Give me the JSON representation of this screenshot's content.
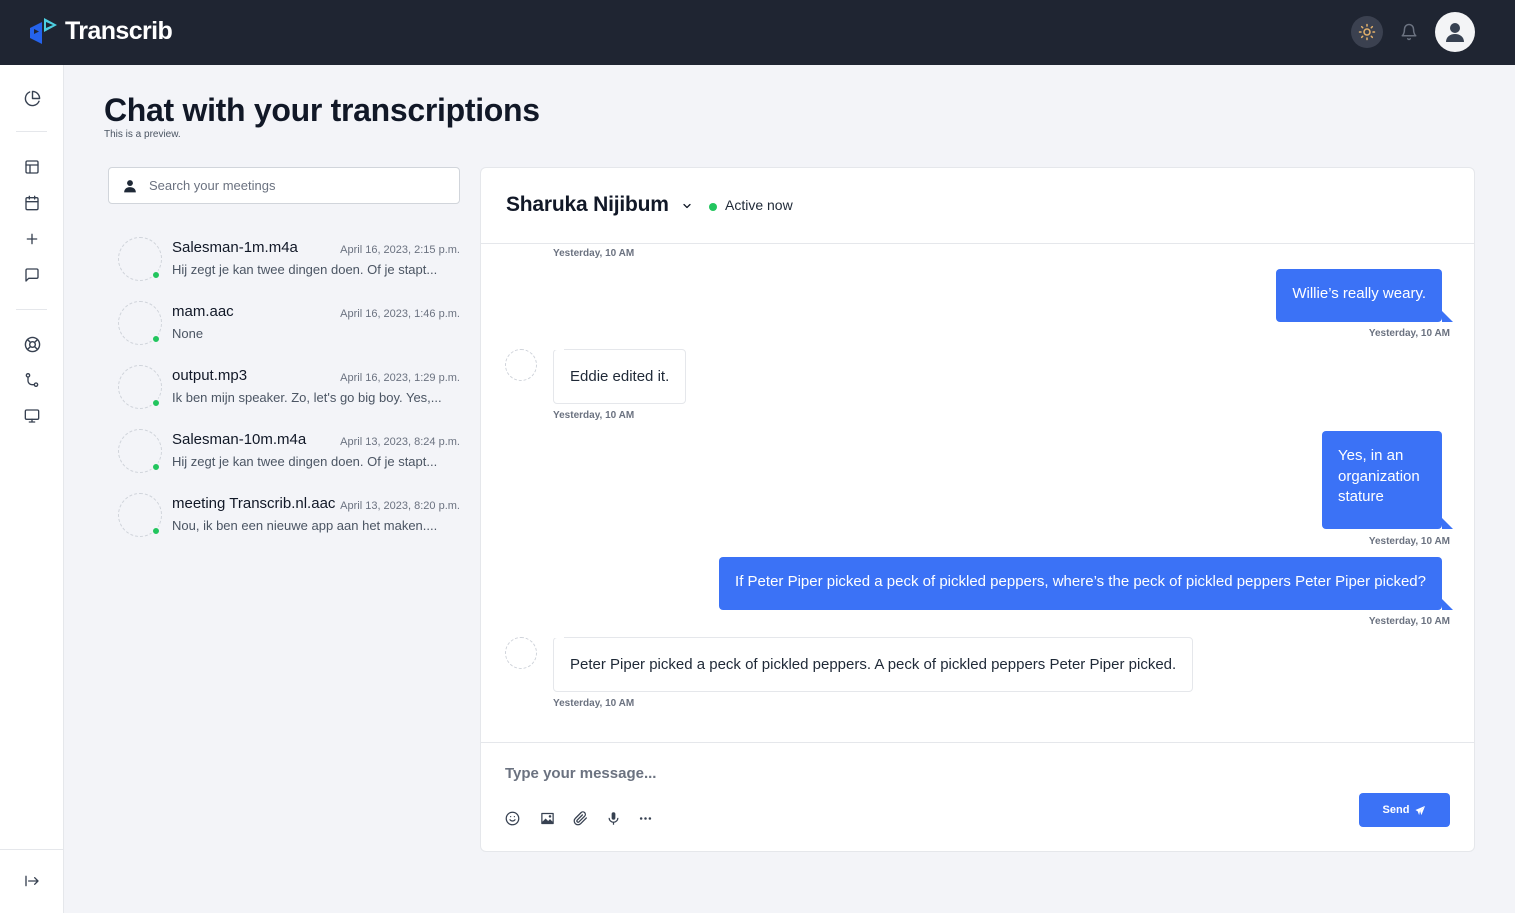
{
  "app": {
    "name": "Transcrib"
  },
  "page": {
    "title": "Chat with your transcriptions",
    "subtitle": "This is a preview."
  },
  "search": {
    "placeholder": "Search your meetings"
  },
  "meetings": [
    {
      "title": "Salesman-1m.m4a",
      "date": "April 16, 2023, 2:15 p.m.",
      "preview": "Hij zegt je kan twee dingen doen. Of je stapt..."
    },
    {
      "title": "mam.aac",
      "date": "April 16, 2023, 1:46 p.m.",
      "preview": "None"
    },
    {
      "title": "output.mp3",
      "date": "April 16, 2023, 1:29 p.m.",
      "preview": "Ik ben mijn speaker. Zo, let's go big boy. Yes,..."
    },
    {
      "title": "Salesman-10m.m4a",
      "date": "April 13, 2023, 8:24 p.m.",
      "preview": "Hij zegt je kan twee dingen doen. Of je stapt..."
    },
    {
      "title": "meeting Transcrib.nl.aac",
      "date": "April 13, 2023, 8:20 p.m.",
      "preview": "Nou, ik ben een nieuwe app aan het maken...."
    }
  ],
  "chat": {
    "contact_name": "Sharuka Nijibum",
    "status": "Active now",
    "messages": [
      {
        "direction": "in",
        "text": "",
        "time": "Yesterday, 10 AM"
      },
      {
        "direction": "out",
        "text": "Willie’s really weary.",
        "time": "Yesterday, 10 AM"
      },
      {
        "direction": "in",
        "text": "Eddie edited it.",
        "time": "Yesterday, 10 AM"
      },
      {
        "direction": "out",
        "text": "Yes, in an organization stature",
        "time": "Yesterday, 10 AM"
      },
      {
        "direction": "out",
        "text": "If Peter Piper picked a peck of pickled peppers, where’s the peck of pickled peppers Peter Piper picked?",
        "time": "Yesterday, 10 AM"
      },
      {
        "direction": "in",
        "text": "Peter Piper picked a peck of pickled peppers. A peck of pickled peppers Peter Piper picked.",
        "time": "Yesterday, 10 AM"
      }
    ],
    "composer_placeholder": "Type your message...",
    "send_label": "Send"
  },
  "colors": {
    "topbar": "#1f2532",
    "accent": "#3b72f6",
    "online": "#22c55e",
    "background": "#f3f4f8"
  },
  "icons": {
    "sidebar": [
      "pie-chart-icon",
      "layout-icon",
      "calendar-icon",
      "plus-icon",
      "chat-icon",
      "lifebuoy-icon",
      "git-branch-icon",
      "monitor-icon",
      "logout-icon"
    ],
    "composer_tools": [
      "emoji-icon",
      "image-icon",
      "attachment-icon",
      "microphone-icon",
      "more-icon"
    ]
  }
}
